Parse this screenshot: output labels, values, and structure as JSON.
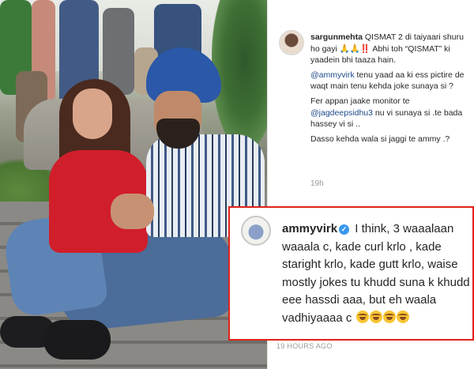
{
  "post": {
    "username": "sargunmehta",
    "caption_line1": "QISMAT 2 di taiyaari shuru ho gayi 🙏🙏‼️ Abhi toh “QISMAT” ki yaadein bhi taaza hain.",
    "mention_ammy": "@ammyvirk",
    "caption_line2": " tenu yaad aa ki ess pictire de waqt main tenu kehda joke sunaya si ?",
    "caption_line3": "Fer appan jaake monitor te ",
    "mention_jagdeep": "@jagdeepsidhu3",
    "caption_line4": " nu vi sunaya si .te bada hassey vi si ..",
    "caption_line5": "Dasso kehda wala si jaggi te ammy .?",
    "time": "19h"
  },
  "comment": {
    "username": "ammyvirk",
    "verified_icon": "✓",
    "text": "I think, 3 waaalaan waaala c, kade curl krlo , kade staright krlo, kade gutt krlo, waise mostly jokes tu khudd suna k khudd eee hassdi aaa, but eh waala vadhiyaaaa c",
    "emoji_count": 4,
    "time": "19 HOURS AGO",
    "highlight_color": "#e0231b"
  },
  "colors": {
    "mention": "#1e4a8a",
    "verified": "#3897f0"
  }
}
